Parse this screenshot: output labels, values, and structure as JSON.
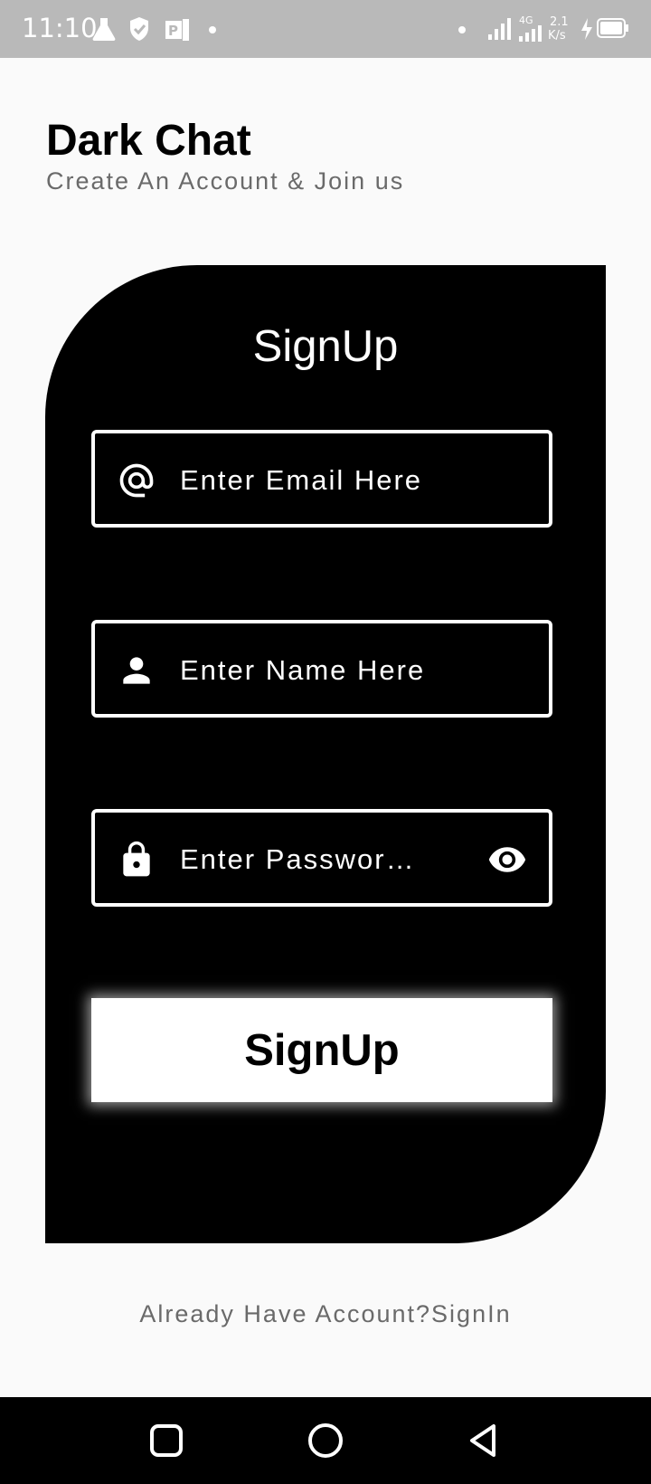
{
  "status_bar": {
    "time": "11:10",
    "network": "4G",
    "speed_value": "2.1",
    "speed_unit": "K/s"
  },
  "header": {
    "title": "Dark Chat",
    "subtitle": "Create An Account & Join us"
  },
  "form": {
    "title": "SignUp",
    "email": {
      "placeholder": "Enter Email Here",
      "icon": "at-icon"
    },
    "name": {
      "placeholder": "Enter Name Here",
      "icon": "person-icon"
    },
    "password": {
      "placeholder": "Enter Passwor…",
      "icon": "lock-icon",
      "toggle_icon": "eye-icon"
    },
    "submit_label": "SignUp"
  },
  "footer": {
    "signin_text": "Already Have Account?SignIn"
  },
  "nav_bar": {
    "buttons": [
      "recents-icon",
      "home-icon",
      "back-icon"
    ]
  },
  "colors": {
    "background": "#fafafa",
    "card": "#000000",
    "accent_text": "#ffffff",
    "muted_text": "#6a6a6a",
    "status_bar": "#b9b9b9"
  }
}
